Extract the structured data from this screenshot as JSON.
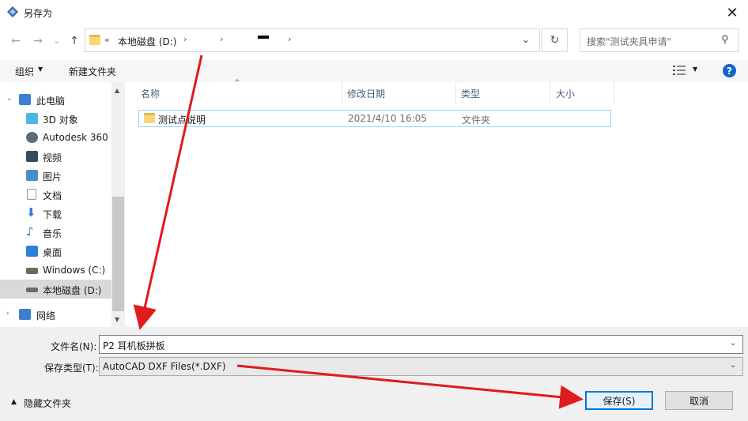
{
  "window": {
    "title": "另存为",
    "close_glyph": "✕"
  },
  "nav": {
    "back": "←",
    "forward": "→",
    "recent": "⌄",
    "up": "↑",
    "address": {
      "prefix": "«",
      "crumb": "本地磁盘 (D:)",
      "sep": "›",
      "dropdown": "⌄"
    },
    "refresh": "↻",
    "search": {
      "placeholder": "搜索\"测试夹具申请\"",
      "icon": "⚲"
    }
  },
  "toolbar": {
    "organize": "组织",
    "organize_dd": "▼",
    "new_folder": "新建文件夹",
    "view_dd": "▼",
    "help": "?"
  },
  "sidebar": {
    "items": [
      {
        "label": "此电脑",
        "icon": "computer-icon",
        "color": "#3a7fd0"
      },
      {
        "label": "3D 对象",
        "icon": "3d-objects-icon",
        "color": "#4fb3e8"
      },
      {
        "label": "Autodesk 360",
        "icon": "cloud-icon",
        "color": "#5a6c80"
      },
      {
        "label": "视频",
        "icon": "video-icon",
        "color": "#3a4a5a"
      },
      {
        "label": "图片",
        "icon": "pictures-icon",
        "color": "#4a90c8"
      },
      {
        "label": "文档",
        "icon": "documents-icon",
        "color": "#8a9aa8"
      },
      {
        "label": "下载",
        "icon": "downloads-icon",
        "color": "#2f7fd8"
      },
      {
        "label": "音乐",
        "icon": "music-icon",
        "color": "#2f7fd8"
      },
      {
        "label": "桌面",
        "icon": "desktop-icon",
        "color": "#2f7fd8"
      },
      {
        "label": "Windows (C:)",
        "icon": "drive-c-icon",
        "color": "#6a6a6a"
      },
      {
        "label": "本地磁盘 (D:)",
        "icon": "drive-d-icon",
        "color": "#6a6a6a"
      },
      {
        "label": "网络",
        "icon": "network-icon",
        "color": "#3a7fd0"
      }
    ],
    "scroll_up": "▲",
    "scroll_down": "▼"
  },
  "filelist": {
    "sort_glyph": "^",
    "columns": [
      "名称",
      "修改日期",
      "类型",
      "大小"
    ],
    "rows": [
      {
        "name": "测试点说明",
        "date": "2021/4/10 16:05",
        "type": "文件夹",
        "size": ""
      }
    ]
  },
  "form": {
    "filename_label": "文件名(N):",
    "filename_value": "P2 耳机板拼板",
    "filetype_label": "保存类型(T):",
    "filetype_value": "AutoCAD DXF Files(*.DXF)",
    "dropdown_glyph": "⌄"
  },
  "footer": {
    "hide_folders": "隐藏文件夹",
    "hide_chev": "▲",
    "save": "保存(S)",
    "cancel": "取消"
  },
  "colors": {
    "accent": "#0078d7",
    "folder": "#f8d775",
    "arrow": "#e01b1b"
  }
}
